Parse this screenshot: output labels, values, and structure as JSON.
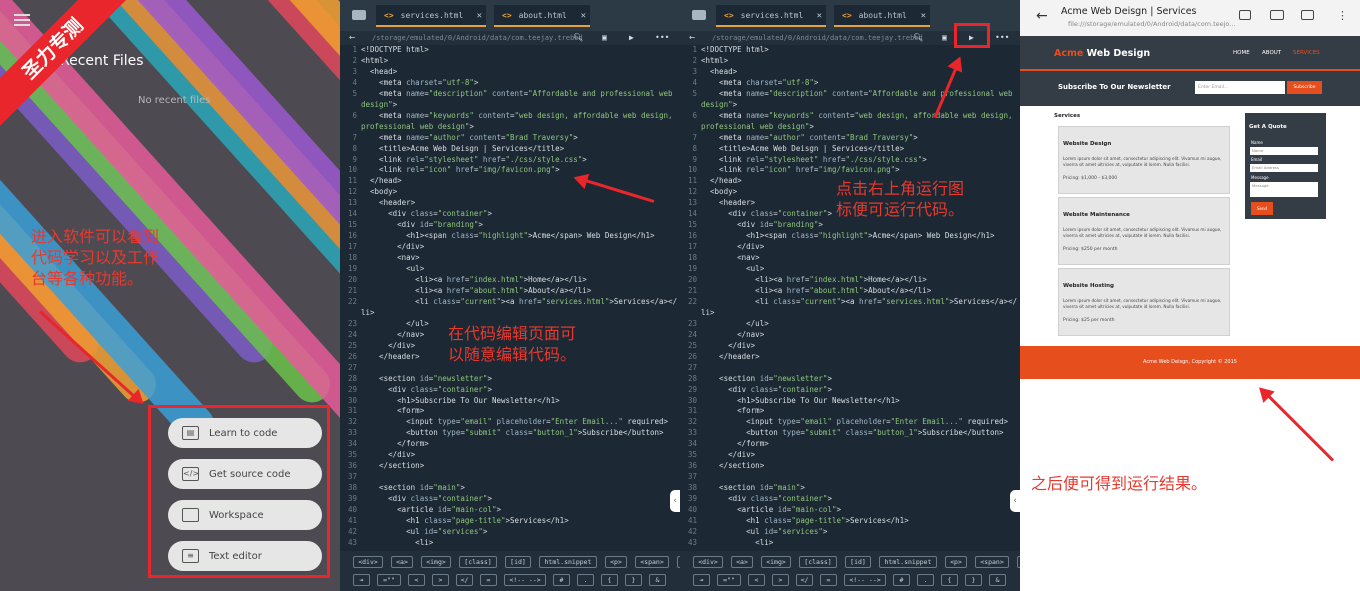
{
  "banner": "圣力专测",
  "launcher": {
    "title": "Recent Files",
    "empty": "No recent files",
    "note": [
      "进入软件可以看到",
      "代码学习以及工作",
      "台等各种功能。"
    ],
    "menu": [
      {
        "icon": "class-icon",
        "label": "Learn to code"
      },
      {
        "icon": "code-icon",
        "label": "Get source code"
      },
      {
        "icon": "folder-icon",
        "label": "Workspace"
      },
      {
        "icon": "doc-icon",
        "label": "Text editor"
      }
    ]
  },
  "editor": {
    "tabs": [
      "services.html",
      "about.html"
    ],
    "path": "/storage/emulated/0/Android/data/com.teejay.trebed",
    "note_edit": [
      "在代码编辑页面可",
      "以随意编辑代码。"
    ],
    "note_run": [
      "点击右上角运行图",
      "标便可运行代码。"
    ],
    "lines": [
      [
        {
          "t": "<!DOCTYPE html>",
          "c": ""
        }
      ],
      [
        {
          "t": "<html>",
          "c": ""
        }
      ],
      [
        {
          "t": "  <head>",
          "c": ""
        }
      ],
      [
        {
          "t": "    <meta ",
          "c": ""
        },
        {
          "t": "charset",
          "c": "a"
        },
        {
          "t": "=",
          "c": ""
        },
        {
          "t": "\"utf-8\"",
          "c": "s"
        },
        {
          "t": ">",
          "c": ""
        }
      ],
      [
        {
          "t": "    <meta ",
          "c": ""
        },
        {
          "t": "name",
          "c": "a"
        },
        {
          "t": "=",
          "c": ""
        },
        {
          "t": "\"description\"",
          "c": "s"
        },
        {
          "t": " content",
          "c": "a"
        },
        {
          "t": "=",
          "c": ""
        },
        {
          "t": "\"Affordable and professional web",
          "c": "s"
        }
      ],
      [
        {
          "t": "design\"",
          "c": "s"
        },
        {
          "t": ">",
          "c": ""
        }
      ],
      [
        {
          "t": "    <meta ",
          "c": ""
        },
        {
          "t": "name",
          "c": "a"
        },
        {
          "t": "=",
          "c": ""
        },
        {
          "t": "\"keywords\"",
          "c": "s"
        },
        {
          "t": " content",
          "c": "a"
        },
        {
          "t": "=",
          "c": ""
        },
        {
          "t": "\"web design, affordable web design,",
          "c": "s"
        }
      ],
      [
        {
          "t": "professional web design\"",
          "c": "s"
        },
        {
          "t": ">",
          "c": ""
        }
      ],
      [
        {
          "t": "    <meta ",
          "c": ""
        },
        {
          "t": "name",
          "c": "a"
        },
        {
          "t": "=",
          "c": ""
        },
        {
          "t": "\"author\"",
          "c": "s"
        },
        {
          "t": " content",
          "c": "a"
        },
        {
          "t": "=",
          "c": ""
        },
        {
          "t": "\"Brad Traversy\"",
          "c": "s"
        },
        {
          "t": ">",
          "c": ""
        }
      ],
      [
        {
          "t": "    <title>Acme Web Deisgn | Services</title>",
          "c": ""
        }
      ],
      [
        {
          "t": "    <link ",
          "c": ""
        },
        {
          "t": "rel",
          "c": "a"
        },
        {
          "t": "=",
          "c": ""
        },
        {
          "t": "\"stylesheet\"",
          "c": "s"
        },
        {
          "t": " href",
          "c": "a"
        },
        {
          "t": "=",
          "c": ""
        },
        {
          "t": "\"./css/style.css\"",
          "c": "s"
        },
        {
          "t": ">",
          "c": ""
        }
      ],
      [
        {
          "t": "    <link ",
          "c": ""
        },
        {
          "t": "rel",
          "c": "a"
        },
        {
          "t": "=",
          "c": ""
        },
        {
          "t": "\"icon\"",
          "c": "s"
        },
        {
          "t": " href",
          "c": "a"
        },
        {
          "t": "=",
          "c": ""
        },
        {
          "t": "\"img/favicon.png\"",
          "c": "s"
        },
        {
          "t": ">",
          "c": ""
        }
      ],
      [
        {
          "t": "  </head>",
          "c": ""
        }
      ],
      [
        {
          "t": "  <body>",
          "c": ""
        }
      ],
      [
        {
          "t": "    <header>",
          "c": ""
        }
      ],
      [
        {
          "t": "      <div ",
          "c": ""
        },
        {
          "t": "class",
          "c": "a"
        },
        {
          "t": "=",
          "c": ""
        },
        {
          "t": "\"container\"",
          "c": "s"
        },
        {
          "t": ">",
          "c": ""
        }
      ],
      [
        {
          "t": "        <div ",
          "c": ""
        },
        {
          "t": "id",
          "c": "a"
        },
        {
          "t": "=",
          "c": ""
        },
        {
          "t": "\"branding\"",
          "c": "s"
        },
        {
          "t": ">",
          "c": ""
        }
      ],
      [
        {
          "t": "          <h1><span ",
          "c": ""
        },
        {
          "t": "class",
          "c": "a"
        },
        {
          "t": "=",
          "c": ""
        },
        {
          "t": "\"highlight\"",
          "c": "s"
        },
        {
          "t": ">Acme</span> Web Design</h1>",
          "c": ""
        }
      ],
      [
        {
          "t": "        </div>",
          "c": ""
        }
      ],
      [
        {
          "t": "        <nav>",
          "c": ""
        }
      ],
      [
        {
          "t": "          <ul>",
          "c": ""
        }
      ],
      [
        {
          "t": "            <li><a ",
          "c": ""
        },
        {
          "t": "href",
          "c": "a"
        },
        {
          "t": "=",
          "c": ""
        },
        {
          "t": "\"index.html\"",
          "c": "s"
        },
        {
          "t": ">Home</a></li>",
          "c": ""
        }
      ],
      [
        {
          "t": "            <li><a ",
          "c": ""
        },
        {
          "t": "href",
          "c": "a"
        },
        {
          "t": "=",
          "c": ""
        },
        {
          "t": "\"about.html\"",
          "c": "s"
        },
        {
          "t": ">About</a></li>",
          "c": ""
        }
      ],
      [
        {
          "t": "            <li ",
          "c": ""
        },
        {
          "t": "class",
          "c": "a"
        },
        {
          "t": "=",
          "c": ""
        },
        {
          "t": "\"current\"",
          "c": "s"
        },
        {
          "t": "><a ",
          "c": ""
        },
        {
          "t": "href",
          "c": "a"
        },
        {
          "t": "=",
          "c": ""
        },
        {
          "t": "\"services.html\"",
          "c": "s"
        },
        {
          "t": ">Services</a></",
          "c": ""
        }
      ],
      [
        {
          "t": "li>",
          "c": ""
        }
      ],
      [
        {
          "t": "          </ul>",
          "c": ""
        }
      ],
      [
        {
          "t": "        </nav>",
          "c": ""
        }
      ],
      [
        {
          "t": "      </div>",
          "c": ""
        }
      ],
      [
        {
          "t": "    </header>",
          "c": ""
        }
      ],
      [
        {
          "t": "",
          "c": ""
        }
      ],
      [
        {
          "t": "    <section ",
          "c": ""
        },
        {
          "t": "id",
          "c": "a"
        },
        {
          "t": "=",
          "c": ""
        },
        {
          "t": "\"newsletter\"",
          "c": "s"
        },
        {
          "t": ">",
          "c": ""
        }
      ],
      [
        {
          "t": "      <div ",
          "c": ""
        },
        {
          "t": "class",
          "c": "a"
        },
        {
          "t": "=",
          "c": ""
        },
        {
          "t": "\"container\"",
          "c": "s"
        },
        {
          "t": ">",
          "c": ""
        }
      ],
      [
        {
          "t": "        <h1>Subscribe To Our Newsletter</h1>",
          "c": ""
        }
      ],
      [
        {
          "t": "        <form>",
          "c": ""
        }
      ],
      [
        {
          "t": "          <input ",
          "c": ""
        },
        {
          "t": "type",
          "c": "a"
        },
        {
          "t": "=",
          "c": ""
        },
        {
          "t": "\"email\"",
          "c": "s"
        },
        {
          "t": " placeholder",
          "c": "a"
        },
        {
          "t": "=",
          "c": ""
        },
        {
          "t": "\"Enter Email...\"",
          "c": "s"
        },
        {
          "t": " required>",
          "c": ""
        }
      ],
      [
        {
          "t": "          <button ",
          "c": ""
        },
        {
          "t": "type",
          "c": "a"
        },
        {
          "t": "=",
          "c": ""
        },
        {
          "t": "\"submit\"",
          "c": "s"
        },
        {
          "t": " class",
          "c": "a"
        },
        {
          "t": "=",
          "c": ""
        },
        {
          "t": "\"button_1\"",
          "c": "s"
        },
        {
          "t": ">Subscribe</button>",
          "c": ""
        }
      ],
      [
        {
          "t": "        </form>",
          "c": ""
        }
      ],
      [
        {
          "t": "      </div>",
          "c": ""
        }
      ],
      [
        {
          "t": "    </section>",
          "c": ""
        }
      ],
      [
        {
          "t": "",
          "c": ""
        }
      ],
      [
        {
          "t": "    <section ",
          "c": ""
        },
        {
          "t": "id",
          "c": "a"
        },
        {
          "t": "=",
          "c": ""
        },
        {
          "t": "\"main\"",
          "c": "s"
        },
        {
          "t": ">",
          "c": ""
        }
      ],
      [
        {
          "t": "      <div ",
          "c": ""
        },
        {
          "t": "class",
          "c": "a"
        },
        {
          "t": "=",
          "c": ""
        },
        {
          "t": "\"container\"",
          "c": "s"
        },
        {
          "t": ">",
          "c": ""
        }
      ],
      [
        {
          "t": "        <article ",
          "c": ""
        },
        {
          "t": "id",
          "c": "a"
        },
        {
          "t": "=",
          "c": ""
        },
        {
          "t": "\"main-col\"",
          "c": "s"
        },
        {
          "t": ">",
          "c": ""
        }
      ],
      [
        {
          "t": "          <h1 ",
          "c": ""
        },
        {
          "t": "class",
          "c": "a"
        },
        {
          "t": "=",
          "c": ""
        },
        {
          "t": "\"page-title\"",
          "c": "s"
        },
        {
          "t": ">Services</h1>",
          "c": ""
        }
      ],
      [
        {
          "t": "          <ul ",
          "c": ""
        },
        {
          "t": "id",
          "c": "a"
        },
        {
          "t": "=",
          "c": ""
        },
        {
          "t": "\"services\"",
          "c": "s"
        },
        {
          "t": ">",
          "c": ""
        }
      ],
      [
        {
          "t": "            <li>",
          "c": ""
        }
      ]
    ],
    "numbers": [
      "1",
      "2",
      "3",
      "4",
      "5",
      "",
      "6",
      "",
      "7",
      "8",
      "9",
      "10",
      "11",
      "12",
      "13",
      "14",
      "15",
      "16",
      "17",
      "18",
      "19",
      "20",
      "21",
      "22",
      "",
      "23",
      "24",
      "25",
      "26",
      "27",
      "28",
      "29",
      "30",
      "31",
      "32",
      "33",
      "34",
      "35",
      "36",
      "37",
      "38",
      "39",
      "40",
      "41",
      "42",
      "43"
    ],
    "keys_row1": [
      "<div>",
      "<a>",
      "<img>",
      "[class]",
      "[id]",
      "html.snippet",
      "<p>",
      "<span>",
      "<br>"
    ],
    "keys_row2": [
      "⇥",
      "=\"\"",
      "<",
      ">",
      "</",
      "=",
      "<!-- -->",
      "#",
      ".",
      "{",
      "}",
      "&"
    ]
  },
  "browser": {
    "title": "Acme Web Deisgn | Services",
    "url": "file:///storage/emulated/0/Android/data/com.teejo...",
    "logo_highlight": "Acme",
    "logo_rest": " Web Design",
    "nav": [
      "HOME",
      "ABOUT",
      "SERVICES"
    ],
    "newsletter_title": "Subscribe To Our Newsletter",
    "email_placeholder": "Enter Email...",
    "subscribe": "Subscribe",
    "services_title": "Services",
    "lorem": "Lorem ipsum dolor sit amet, consectetur adipiscing elit. Vivamus mi augue, viverra sit amet ultricies at, vulputate id lorem. Nulla facilisi.",
    "services": [
      {
        "title": "Website Design",
        "price": "Pricing: $1,000 - $3,000"
      },
      {
        "title": "Website Maintenance",
        "price": "Pricing: $250 per month"
      },
      {
        "title": "Website Hosting",
        "price": "Pricing: $25 per month"
      }
    ],
    "quote_title": "Get A Quote",
    "quote_name_label": "Name",
    "quote_name_ph": "Name",
    "quote_email_label": "Email",
    "quote_email_ph": "Email Address",
    "quote_msg_label": "Message",
    "quote_msg_ph": "Message",
    "send": "Send",
    "footer": "Acme Web Deisgn, Copyright © 2015",
    "note": "之后便可得到运行结果。"
  },
  "colors": {
    "annotation": "#e8262c",
    "editor_bg": "#1c2833",
    "site_dark": "#343d45",
    "site_accent": "#e64e1e"
  }
}
